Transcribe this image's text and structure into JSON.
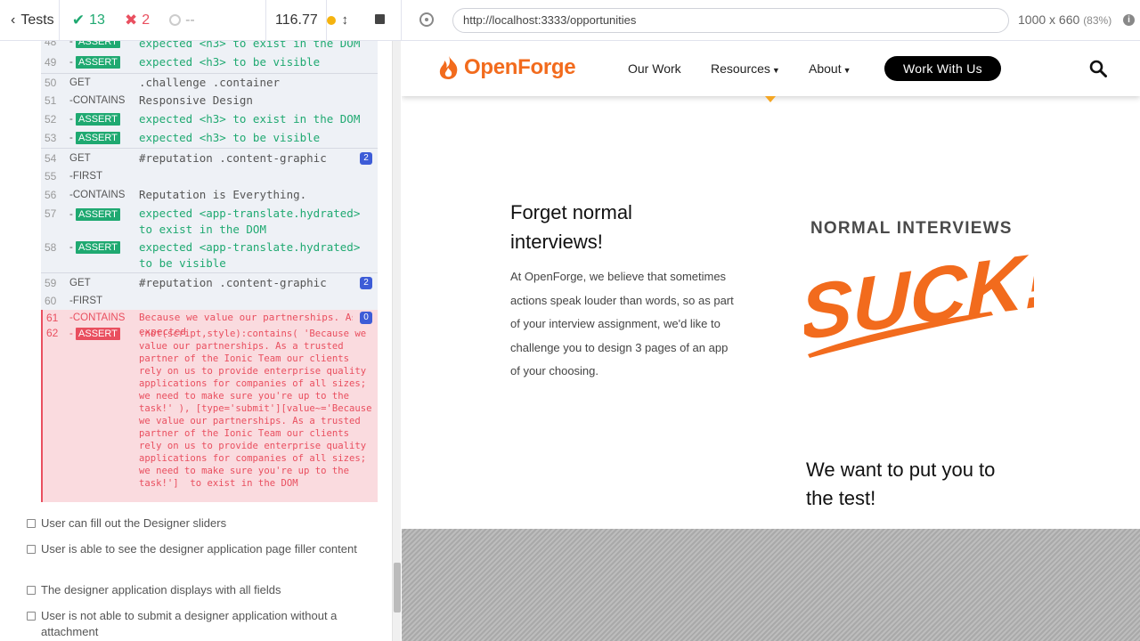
{
  "header": {
    "tests_label": "Tests",
    "passed": "13",
    "failed": "2",
    "pending": "--",
    "duration": "116.77"
  },
  "commands": [
    {
      "num": "48",
      "name": "-ASSERT",
      "msg": "expected <h3> to exist in the DOM"
    },
    {
      "num": "49",
      "name": "-ASSERT",
      "msg": "expected <h3> to be visible"
    },
    {
      "num": "50",
      "name": "GET",
      "msg": ".challenge .container"
    },
    {
      "num": "51",
      "name": "-CONTAINS",
      "msg": "Responsive Design"
    },
    {
      "num": "52",
      "name": "-ASSERT",
      "msg": "expected <h3> to exist in the DOM"
    },
    {
      "num": "53",
      "name": "-ASSERT",
      "msg": "expected <h3> to be visible"
    },
    {
      "num": "54",
      "name": "GET",
      "msg": "#reputation .content-graphic",
      "count": "2"
    },
    {
      "num": "55",
      "name": "-FIRST",
      "msg": ""
    },
    {
      "num": "56",
      "name": "-CONTAINS",
      "msg": "Reputation is Everything."
    },
    {
      "num": "57",
      "name": "-ASSERT",
      "msg": "expected <app-translate.hydrated> to exist in the DOM"
    },
    {
      "num": "58",
      "name": "-ASSERT",
      "msg": "expected <app-translate.hydrated> to be visible"
    },
    {
      "num": "59",
      "name": "GET",
      "msg": "#reputation .content-graphic",
      "count": "2"
    },
    {
      "num": "60",
      "name": "-FIRST",
      "msg": ""
    }
  ],
  "failed_commands": {
    "contains_num": "61",
    "contains_name": "-CONTAINS",
    "contains_msg": "Because we value our partnerships. As …",
    "contains_count": "0",
    "assert_num": "62",
    "assert_name": "-ASSERT",
    "assert_msg_head": "expected",
    "assert_msg_body": ":not(script,style):contains( 'Because we value our partnerships. As a trusted partner of the Ionic Team our clients rely on us to provide enterprise quality applications for companies of all sizes; we need to make sure you're up to the task!' ), [type='submit'][value~='Because we value our partnerships. As a trusted partner of the Ionic Team our clients rely on us to provide enterprise quality applications for companies of all sizes; we need to make sure you're up to the task!']  to exist in the DOM"
  },
  "tests": [
    "User can fill out the Designer sliders",
    "User is able to see the designer application page filler content",
    "The designer application displays with all fields",
    "User is not able to submit a designer application without a attachment"
  ],
  "browser": {
    "url": "http://localhost:3333/opportunities",
    "viewport": "1000 x 660",
    "zoom": "(83%)"
  },
  "site": {
    "logo_text": "OpenForge",
    "nav": [
      "Our Work",
      "Resources",
      "About"
    ],
    "cta": "Work With Us",
    "heading_1": "Forget normal interviews!",
    "body_1": "At OpenForge, we believe that sometimes actions speak louder than words, so as part of your interview assignment, we'd like to challenge you to design 3 pages of an app of your choosing.",
    "normal_interviews": "NORMAL INTERVIEWS",
    "suck_text": "SUCK!",
    "heading_2": "We want to put you to the test!",
    "brand_color": "#f26b1d"
  }
}
